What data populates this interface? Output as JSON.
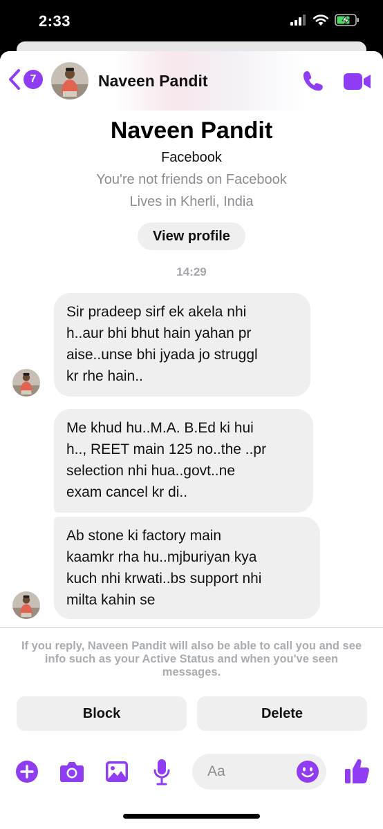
{
  "status_bar": {
    "time": "2:33",
    "icons": [
      "cellular-signal-icon",
      "wifi-icon",
      "battery-charging-icon"
    ]
  },
  "header": {
    "back_badge_count": "7",
    "contact_name": "Naveen Pandit",
    "icons": [
      "chevron-left-icon",
      "phone-icon",
      "video-camera-icon"
    ]
  },
  "profile": {
    "name": "Naveen Pandit",
    "source": "Facebook",
    "friend_status": "You're not friends on Facebook",
    "lives_in": "Lives in Kherli, India",
    "view_profile_label": "View profile"
  },
  "conversation": {
    "timestamp": "14:29",
    "messages": [
      {
        "lines": [
          "Sir pradeep sirf ek akela nhi",
          "h..aur bhi bhut hain yahan pr",
          "aise..unse bhi jyada jo struggl",
          "kr rhe hain.."
        ]
      },
      {
        "lines": [
          "Me khud hu..M.A. B.Ed ki hui",
          "h.., REET main 125 no..the ..pr",
          "selection nhi hua..govt..ne",
          "exam cancel kr di.."
        ]
      },
      {
        "lines": [
          "Ab stone ki factory main",
          "kaamkr rha hu..mjburiyan kya",
          "kuch nhi krwati..bs support nhi",
          "milta kahin se"
        ]
      }
    ]
  },
  "request": {
    "notice": "If you reply, Naveen Pandit will also be able to call you and see info such as your Active Status and when you've seen messages.",
    "block_label": "Block",
    "delete_label": "Delete"
  },
  "composer": {
    "placeholder": "Aa",
    "icons": [
      "plus-circle-icon",
      "camera-icon",
      "photo-icon",
      "microphone-icon",
      "emoji-icon",
      "thumbs-up-icon"
    ]
  },
  "colors": {
    "accent": "#8f3cf3",
    "bubble": "#efefef",
    "muted_text": "#8a8d91"
  }
}
